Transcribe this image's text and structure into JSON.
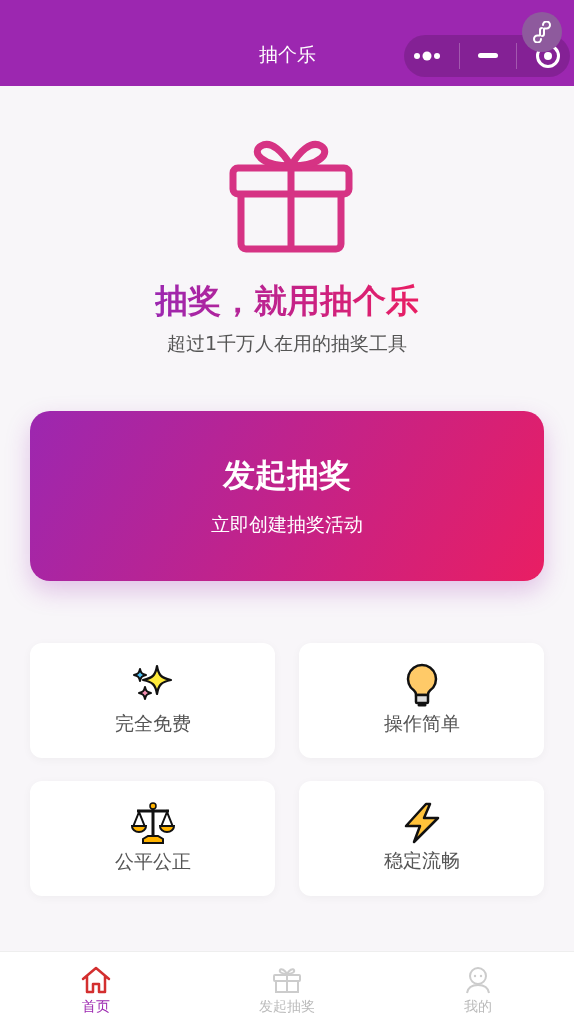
{
  "navbar": {
    "title": "抽个乐"
  },
  "hero": {
    "title": "抽奖，就用抽个乐",
    "subtitle": "超过1千万人在用的抽奖工具"
  },
  "cta": {
    "title": "发起抽奖",
    "subtitle": "立即创建抽奖活动"
  },
  "features": [
    {
      "kind": "sparkles",
      "label": "完全免费"
    },
    {
      "kind": "bulb",
      "label": "操作简单"
    },
    {
      "kind": "scales",
      "label": "公平公正"
    },
    {
      "kind": "bolt",
      "label": "稳定流畅"
    }
  ],
  "tabs": [
    {
      "kind": "home",
      "label": "首页",
      "selected": true
    },
    {
      "kind": "gift",
      "label": "发起抽奖",
      "selected": false
    },
    {
      "kind": "person",
      "label": "我的",
      "selected": false
    }
  ]
}
